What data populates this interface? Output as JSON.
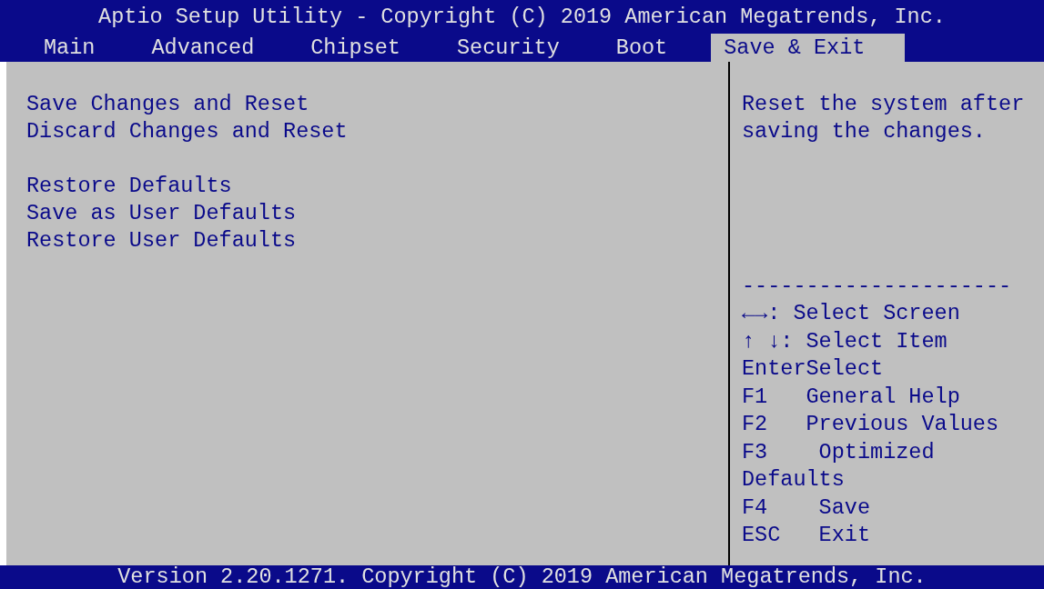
{
  "title": "Aptio Setup Utility - Copyright (C) 2019 American Megatrends, Inc.",
  "tabs": [
    {
      "label": "Main",
      "selected": false
    },
    {
      "label": "Advanced",
      "selected": false
    },
    {
      "label": "Chipset",
      "selected": false
    },
    {
      "label": "Security",
      "selected": false
    },
    {
      "label": "Boot",
      "selected": false
    },
    {
      "label": "Save & Exit",
      "selected": true
    }
  ],
  "menu_groups": [
    [
      "Save Changes and Reset",
      "Discard Changes and Reset"
    ],
    [
      "Restore Defaults",
      "Save as User Defaults",
      "Restore User Defaults"
    ]
  ],
  "help_text": "Reset the system after saving the changes.",
  "separator": "---------------------",
  "key_help": [
    "←→: Select Screen",
    "↑ ↓: Select Item",
    "EnterSelect",
    "F1   General Help",
    "F2   Previous Values",
    "F3    Optimized",
    "Defaults",
    "F4    Save",
    "ESC   Exit"
  ],
  "footer": "Version 2.20.1271. Copyright (C) 2019 American Megatrends, Inc."
}
